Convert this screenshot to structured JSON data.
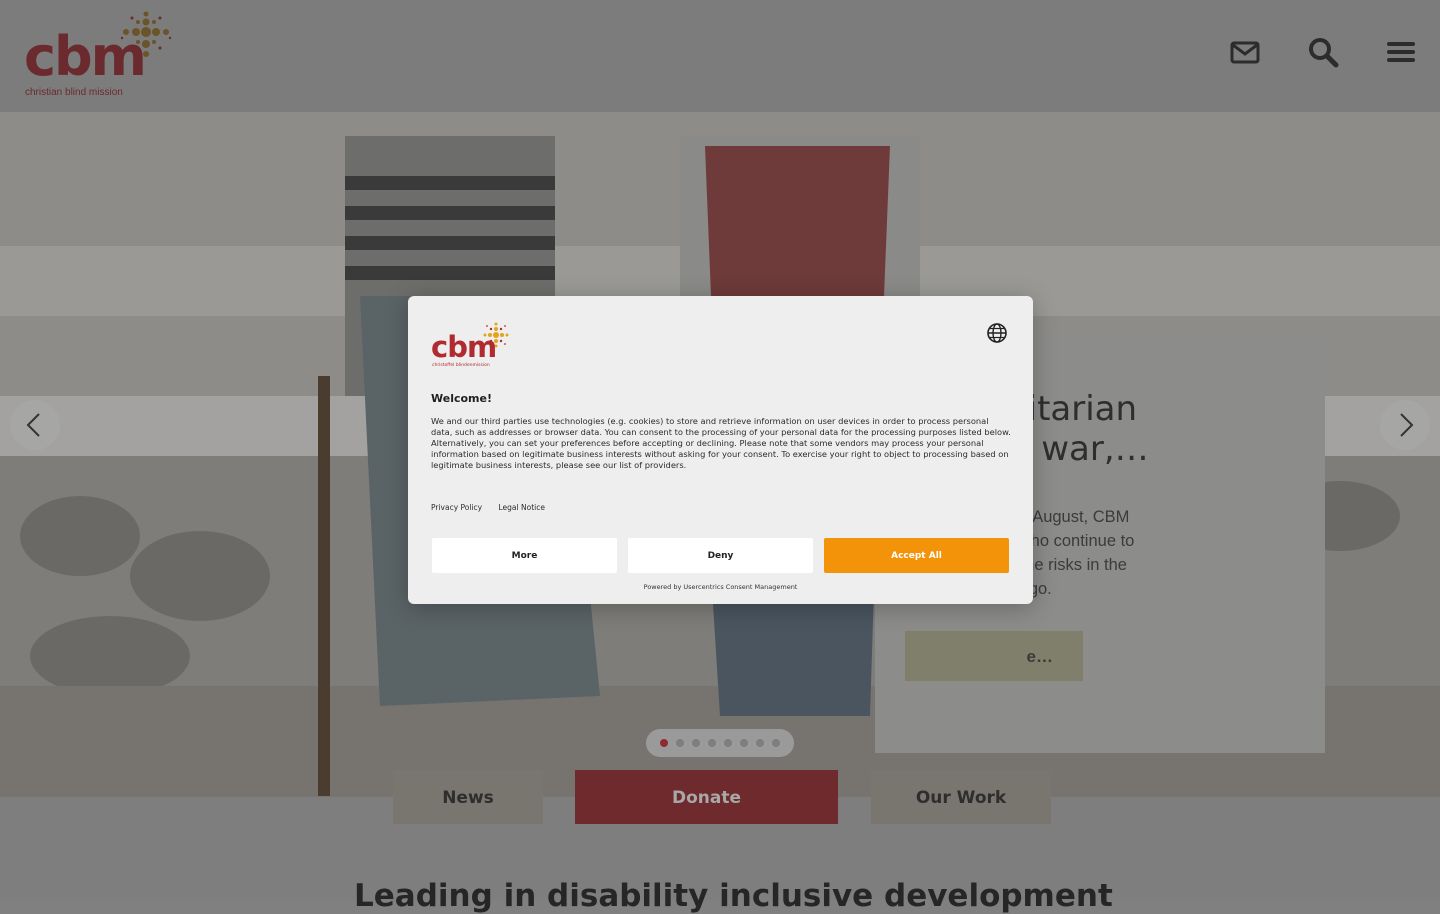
{
  "header": {
    "logo_text": "cbm",
    "logo_subtitle": "christian blind mission",
    "icons": [
      "mail-icon",
      "search-icon",
      "menu-icon"
    ]
  },
  "hero": {
    "title": "Humanitarian\netween war,…",
    "text": "anitarian Day, 19 August, CBM\nn to the people who continue to\nreas despite all the risks in the\npublic of the Congo.",
    "button_label": "e…",
    "slide_count": 8,
    "active_slide": 1
  },
  "tabs": [
    {
      "label": "News"
    },
    {
      "label": "Donate"
    },
    {
      "label": "Our Work"
    }
  ],
  "section_heading": "Leading in disability inclusive development",
  "consent": {
    "logo_text": "cbm",
    "logo_subtitle": "christoffel blindenmission",
    "title": "Welcome!",
    "body": "We and our third parties use technologies (e.g. cookies) to store and retrieve information on user devices in order to process personal data, such as addresses or browser data. You can consent to the processing of your personal data for the processing purposes listed below. Alternatively, you can set your preferences before accepting or declining. Please note that some vendors may process your personal information based on legitimate business interests without asking for your consent. To exercise your right to object to processing based on legitimate business interests, please see our list of providers.",
    "links": [
      "Privacy Policy",
      "Legal Notice"
    ],
    "buttons": {
      "more": "More",
      "deny": "Deny",
      "accept": "Accept All"
    },
    "footer": "Powered by Usercentrics Consent Management"
  },
  "colors": {
    "brand_red": "#b02a30",
    "accept_orange": "#f2930a",
    "overlay": "#808080"
  }
}
